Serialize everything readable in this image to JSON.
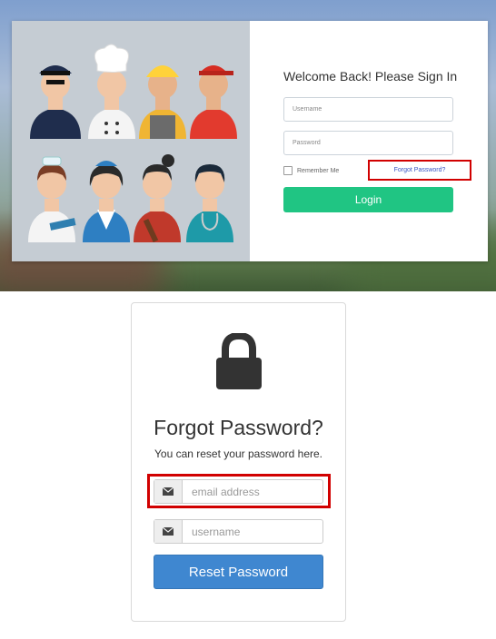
{
  "login": {
    "welcome": "Welcome Back! Please Sign In",
    "username_placeholder": "Username",
    "password_placeholder": "Password",
    "remember_label": "Remember Me",
    "forgot_link": "Forgot Password?",
    "login_button": "Login",
    "colors": {
      "accent": "#20c583",
      "link": "#3a56c5",
      "highlight": "#d10000"
    },
    "illustration_icon": "professions-illustration"
  },
  "reset": {
    "icon": "lock-icon",
    "title": "Forgot Password?",
    "subtitle": "You can reset your password here.",
    "email_placeholder": "email address",
    "username_placeholder": "username",
    "field_icon": "envelope-icon",
    "button": "Reset Password",
    "colors": {
      "button": "#3f87d0",
      "highlight": "#d10000"
    }
  }
}
